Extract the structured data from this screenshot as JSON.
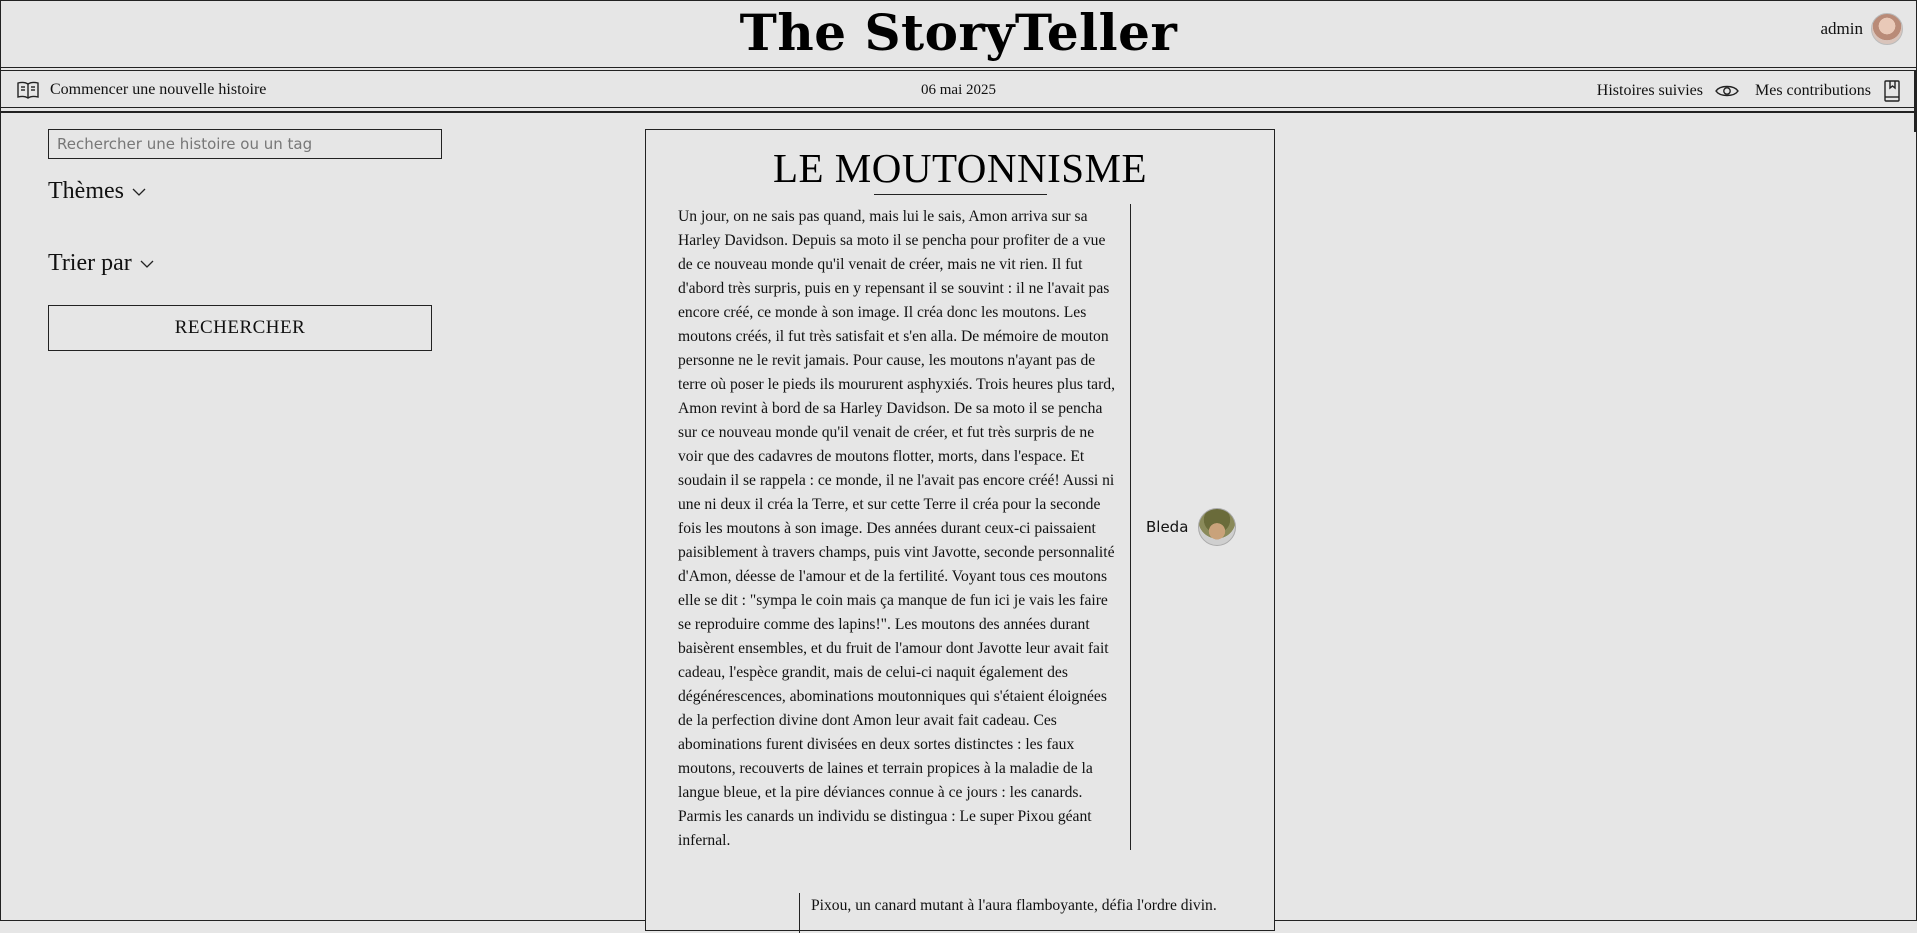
{
  "header": {
    "logo": "The StoryTeller",
    "user": {
      "name": "admin"
    }
  },
  "nav": {
    "new_story": "Commencer une nouvelle histoire",
    "date": "06 mai 2025",
    "followed": "Histoires suivies",
    "contributions": "Mes contributions",
    "icons": {
      "new_story": "open-book-icon",
      "followed": "eye-icon",
      "contributions": "bookmark-book-icon"
    }
  },
  "sidebar": {
    "search_placeholder": "Rechercher une histoire ou un tag",
    "themes_label": "Thèmes",
    "sort_label": "Trier par",
    "search_button": "RECHERCHER"
  },
  "story": {
    "title": "LE MOUTONNISME",
    "chapters": [
      {
        "author": "Bleda",
        "text": "Un jour, on ne sais pas quand, mais lui le sais, Amon arriva sur sa Harley Davidson. Depuis sa moto il se pencha pour profiter de a vue de ce nouveau monde qu'il venait de créer, mais ne vit rien. Il fut d'abord très surpris, puis en y repensant il se souvint : il ne l'avait pas encore créé, ce monde à son image. Il créa donc les moutons. Les moutons créés, il fut très satisfait et s'en alla. De mémoire de mouton personne ne le revit jamais. Pour cause, les moutons n'ayant pas de terre où poser le pieds ils moururent asphyxiés. Trois heures plus tard, Amon revint à bord de sa Harley Davidson. De sa moto il se pencha sur ce nouveau monde qu'il venait de créer, et fut très surpris de ne voir que des cadavres de moutons flotter, morts, dans l'espace. Et soudain il se rappela : ce monde, il ne l'avait pas encore créé! Aussi ni une ni deux il créa la Terre, et sur cette Terre il créa pour la seconde fois les moutons à son image. Des années durant ceux-ci paissaient paisiblement à travers champs, puis vint Javotte, seconde personnalité d'Amon, déesse de l'amour et de la fertilité. Voyant tous ces moutons elle se dit : \"sympa le coin mais ça manque de fun ici je vais les faire se reproduire comme des lapins!\". Les moutons des années durant baisèrent ensembles, et du fruit de l'amour dont Javotte leur avait fait cadeau, l'espèce grandit, mais de celui-ci naquit également des dégénérescences, abominations moutonniques qui s'étaient éloignées de la perfection divine dont Amon leur avait fait cadeau. Ces abominations furent divisées en deux sortes distinctes : les faux moutons, recouverts de laines et terrain propices à la maladie de la langue bleue, et la pire déviances connue à ce jours : les canards. Parmis les canards un individu se distingua : Le super Pixou géant infernal."
      },
      {
        "text": "Pixou, un canard mutant à l'aura flamboyante, défia l'ordre divin."
      }
    ]
  }
}
